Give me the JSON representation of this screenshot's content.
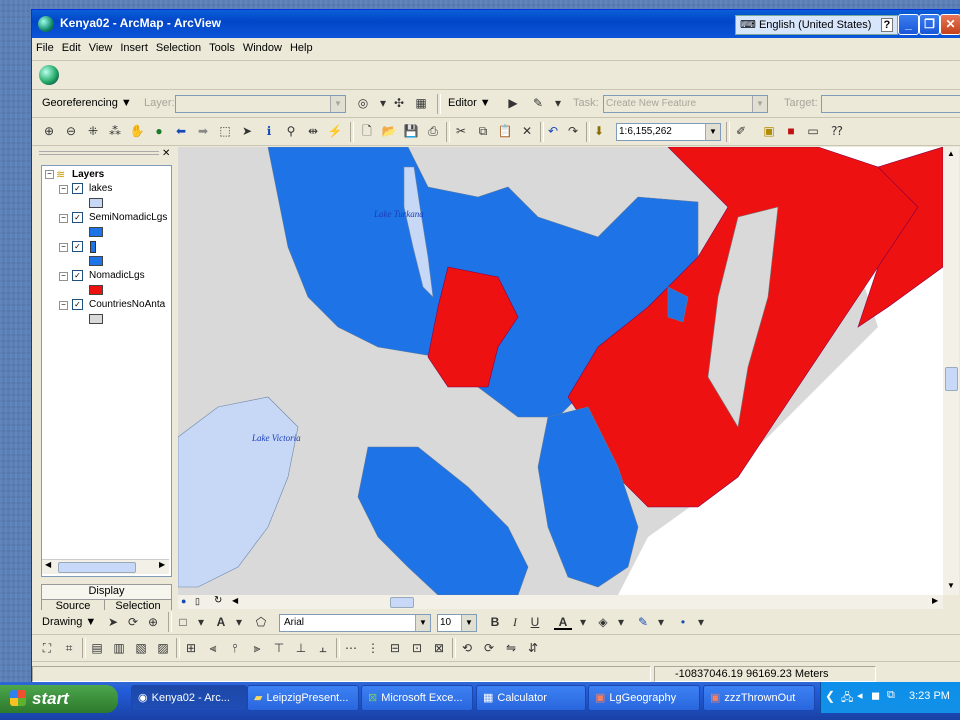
{
  "window": {
    "title": "Kenya02 - ArcMap - ArcView",
    "language": "English (United States)"
  },
  "menu": [
    "File",
    "Edit",
    "View",
    "Insert",
    "Selection",
    "Tools",
    "Window",
    "Help"
  ],
  "georef": {
    "label": "Georeferencing ▼",
    "layer_label": "Layer:",
    "editor_label": "Editor ▼",
    "task_label": "Task:",
    "task_value": "Create New Feature",
    "target_label": "Target:"
  },
  "tools": {
    "scale": "1:6,155,262"
  },
  "toc": {
    "root": "Layers",
    "layers": [
      {
        "name": "lakes",
        "color": "#c6d8f6"
      },
      {
        "name": "SemiNomadicLgs",
        "color": "#1e73e6"
      },
      {
        "name": "",
        "color": "#1e73e6"
      },
      {
        "name": "NomadicLgs",
        "color": "#ee1111"
      },
      {
        "name": "CountriesNoAnta",
        "color": "#d9d9d9"
      }
    ],
    "tabs": {
      "display": "Display",
      "source": "Source",
      "selection": "Selection"
    }
  },
  "map": {
    "labels": {
      "lake_turkana": "Lake Turkana",
      "lake_victoria": "Lake Victoria"
    },
    "colors": {
      "semi_nomadic": "#1e73e6",
      "nomadic": "#ee1111",
      "lakes": "#c6d8f6",
      "countries": "#d9d9d9",
      "ocean": "#ffffff"
    }
  },
  "drawing": {
    "label": "Drawing ▼",
    "font": "Arial",
    "size": "10"
  },
  "status": {
    "coords": "-10837046.19  96169.23 Meters"
  },
  "taskbar": {
    "start": "start",
    "tasks": [
      "Kenya02 - Arc...",
      "LeipzigPresent...",
      "Microsoft Exce...",
      "Calculator",
      "LgGeography",
      "zzzThrownOut"
    ],
    "time": "3:23 PM"
  }
}
